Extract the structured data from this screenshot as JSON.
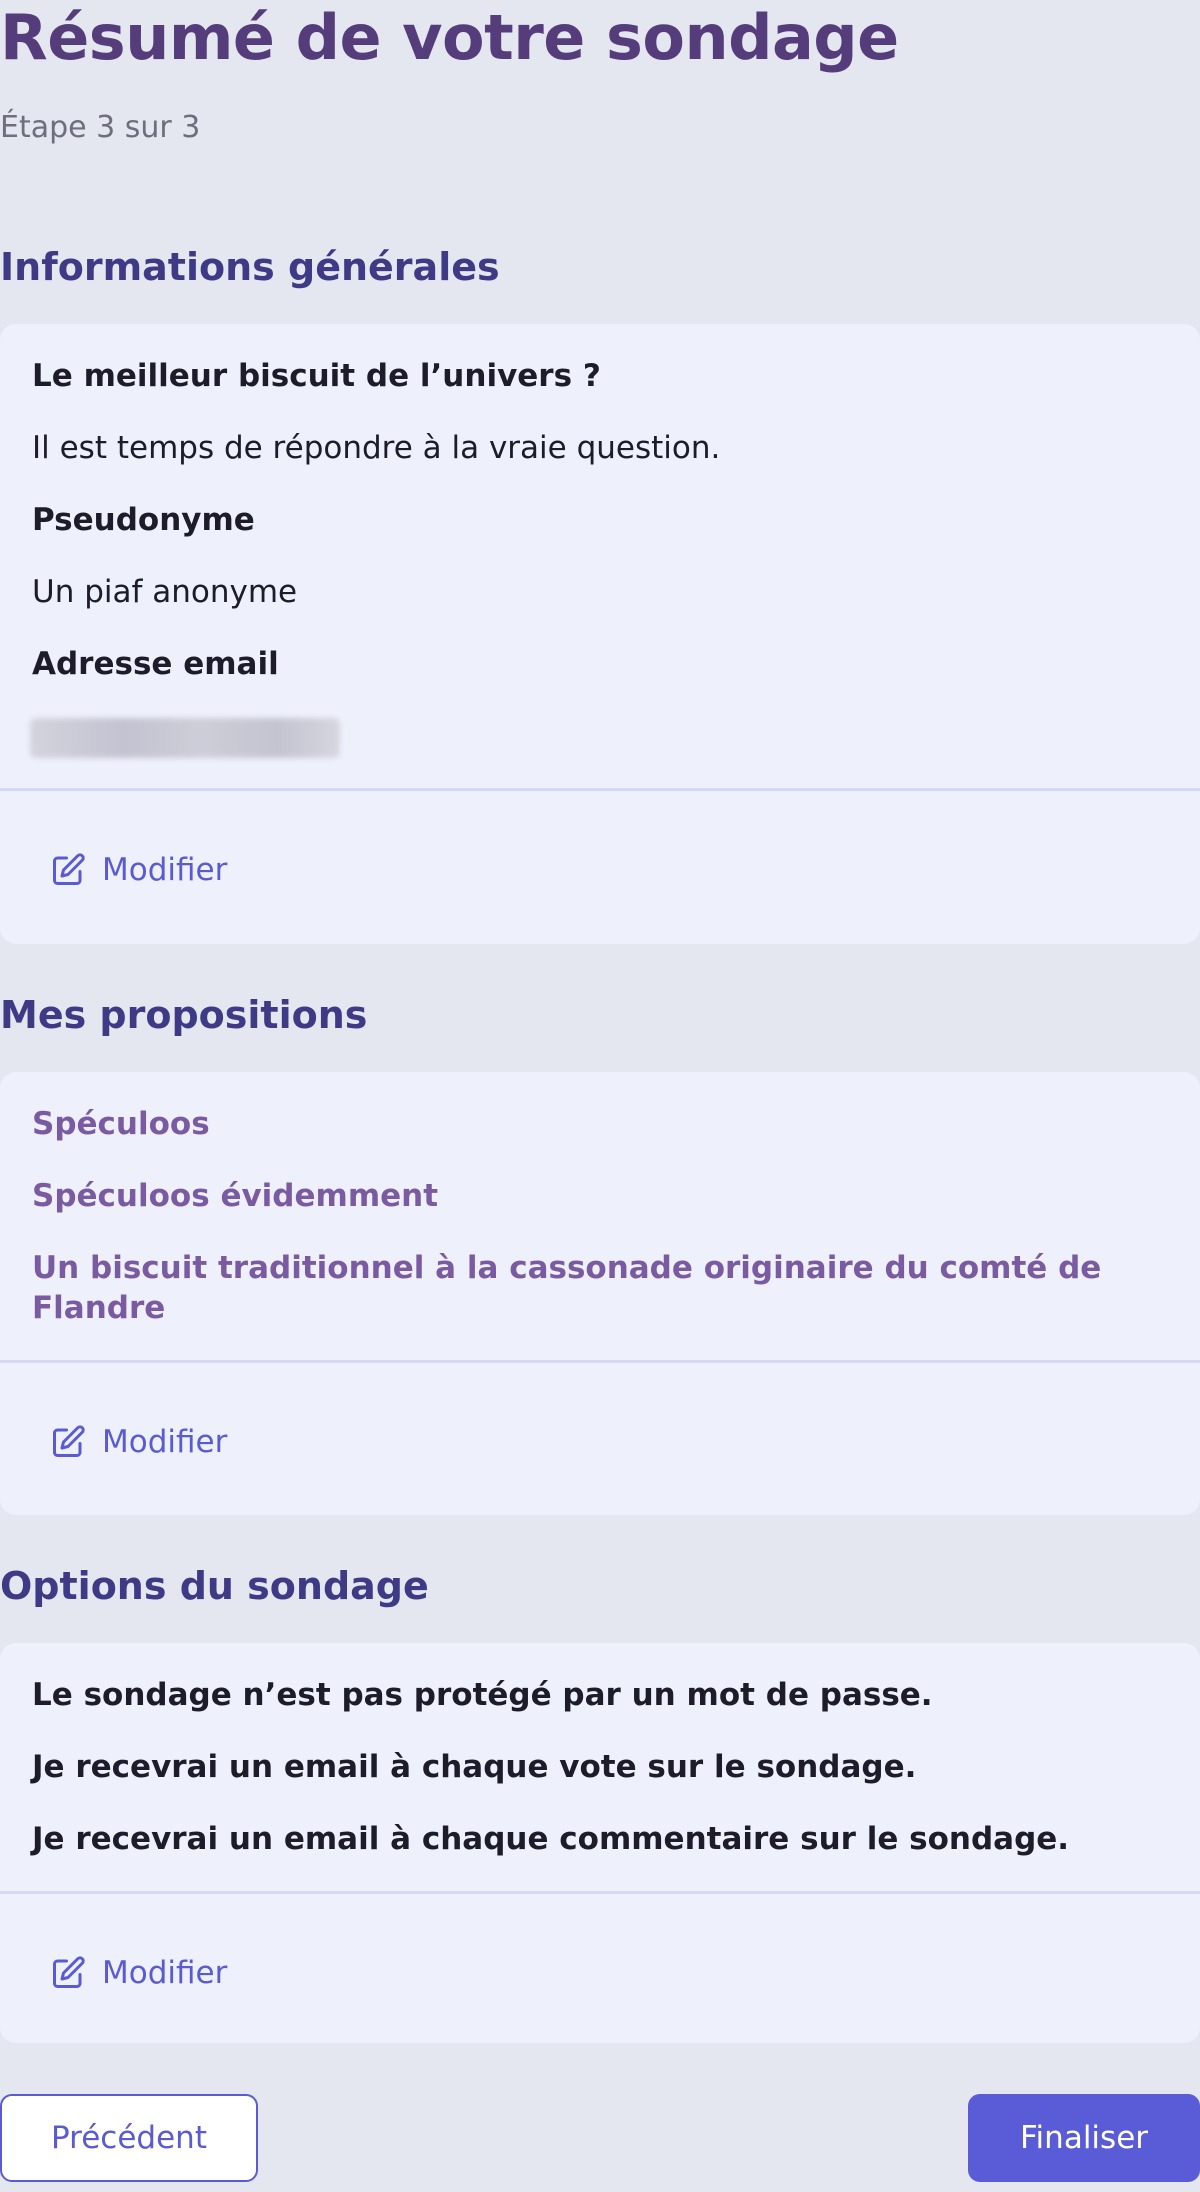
{
  "header": {
    "title": "Résumé de votre sondage",
    "step": "Étape 3 sur 3"
  },
  "general": {
    "section_title": "Informations générales",
    "poll_title": "Le meilleur biscuit de l’univers ?",
    "poll_description": "Il est temps de répondre à la vraie question.",
    "nickname_label": "Pseudonyme",
    "nickname_value": "Un piaf anonyme",
    "email_label": "Adresse email",
    "modify_label": "Modifier"
  },
  "proposals": {
    "section_title": "Mes propositions",
    "items": [
      "Spéculoos",
      "Spéculoos évidemment",
      "Un biscuit traditionnel à la cassonade originaire du comté de Flandre"
    ],
    "modify_label": "Modifier"
  },
  "options": {
    "section_title": "Options du sondage",
    "items": [
      "Le sondage n’est pas protégé par un mot de passe.",
      "Je recevrai un email à chaque vote sur le sondage.",
      "Je recevrai un email à chaque commentaire sur le sondage."
    ],
    "modify_label": "Modifier"
  },
  "footer": {
    "previous_label": "Précédent",
    "finalize_label": "Finaliser"
  },
  "icons": {
    "modify": "edit-icon"
  },
  "colors": {
    "background": "#e4e7f0",
    "card": "#eef0fc",
    "title": "#553d7c",
    "section_title": "#3f3a86",
    "accent": "#5a5bd2",
    "proposal_text": "#7a5aa0"
  }
}
